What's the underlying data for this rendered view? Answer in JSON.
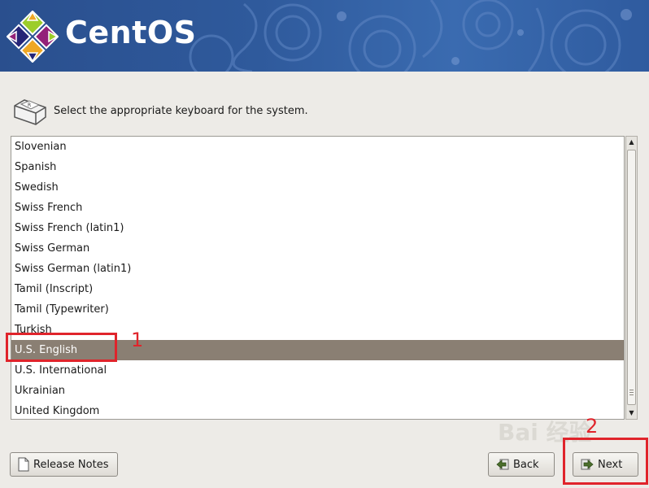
{
  "banner": {
    "brand_name": "CentOS",
    "accent_color": "#2f5a9c"
  },
  "prompt": {
    "icon": "keyboard-icon",
    "text": "Select the appropriate keyboard for the system."
  },
  "keyboard_list": {
    "items": [
      "Slovenian",
      "Spanish",
      "Swedish",
      "Swiss French",
      "Swiss French (latin1)",
      "Swiss German",
      "Swiss German (latin1)",
      "Tamil (Inscript)",
      "Tamil (Typewriter)",
      "Turkish",
      "U.S. English",
      "U.S. International",
      "Ukrainian",
      "United Kingdom"
    ],
    "selected": "U.S. English",
    "selected_color": "#8a7f73"
  },
  "buttons": {
    "release_notes": "Release Notes",
    "back": "Back",
    "next": "Next"
  },
  "annotations": {
    "one": "1",
    "two": "2",
    "color": "#e0242b"
  },
  "watermark": {
    "text": "Bai 经验"
  }
}
